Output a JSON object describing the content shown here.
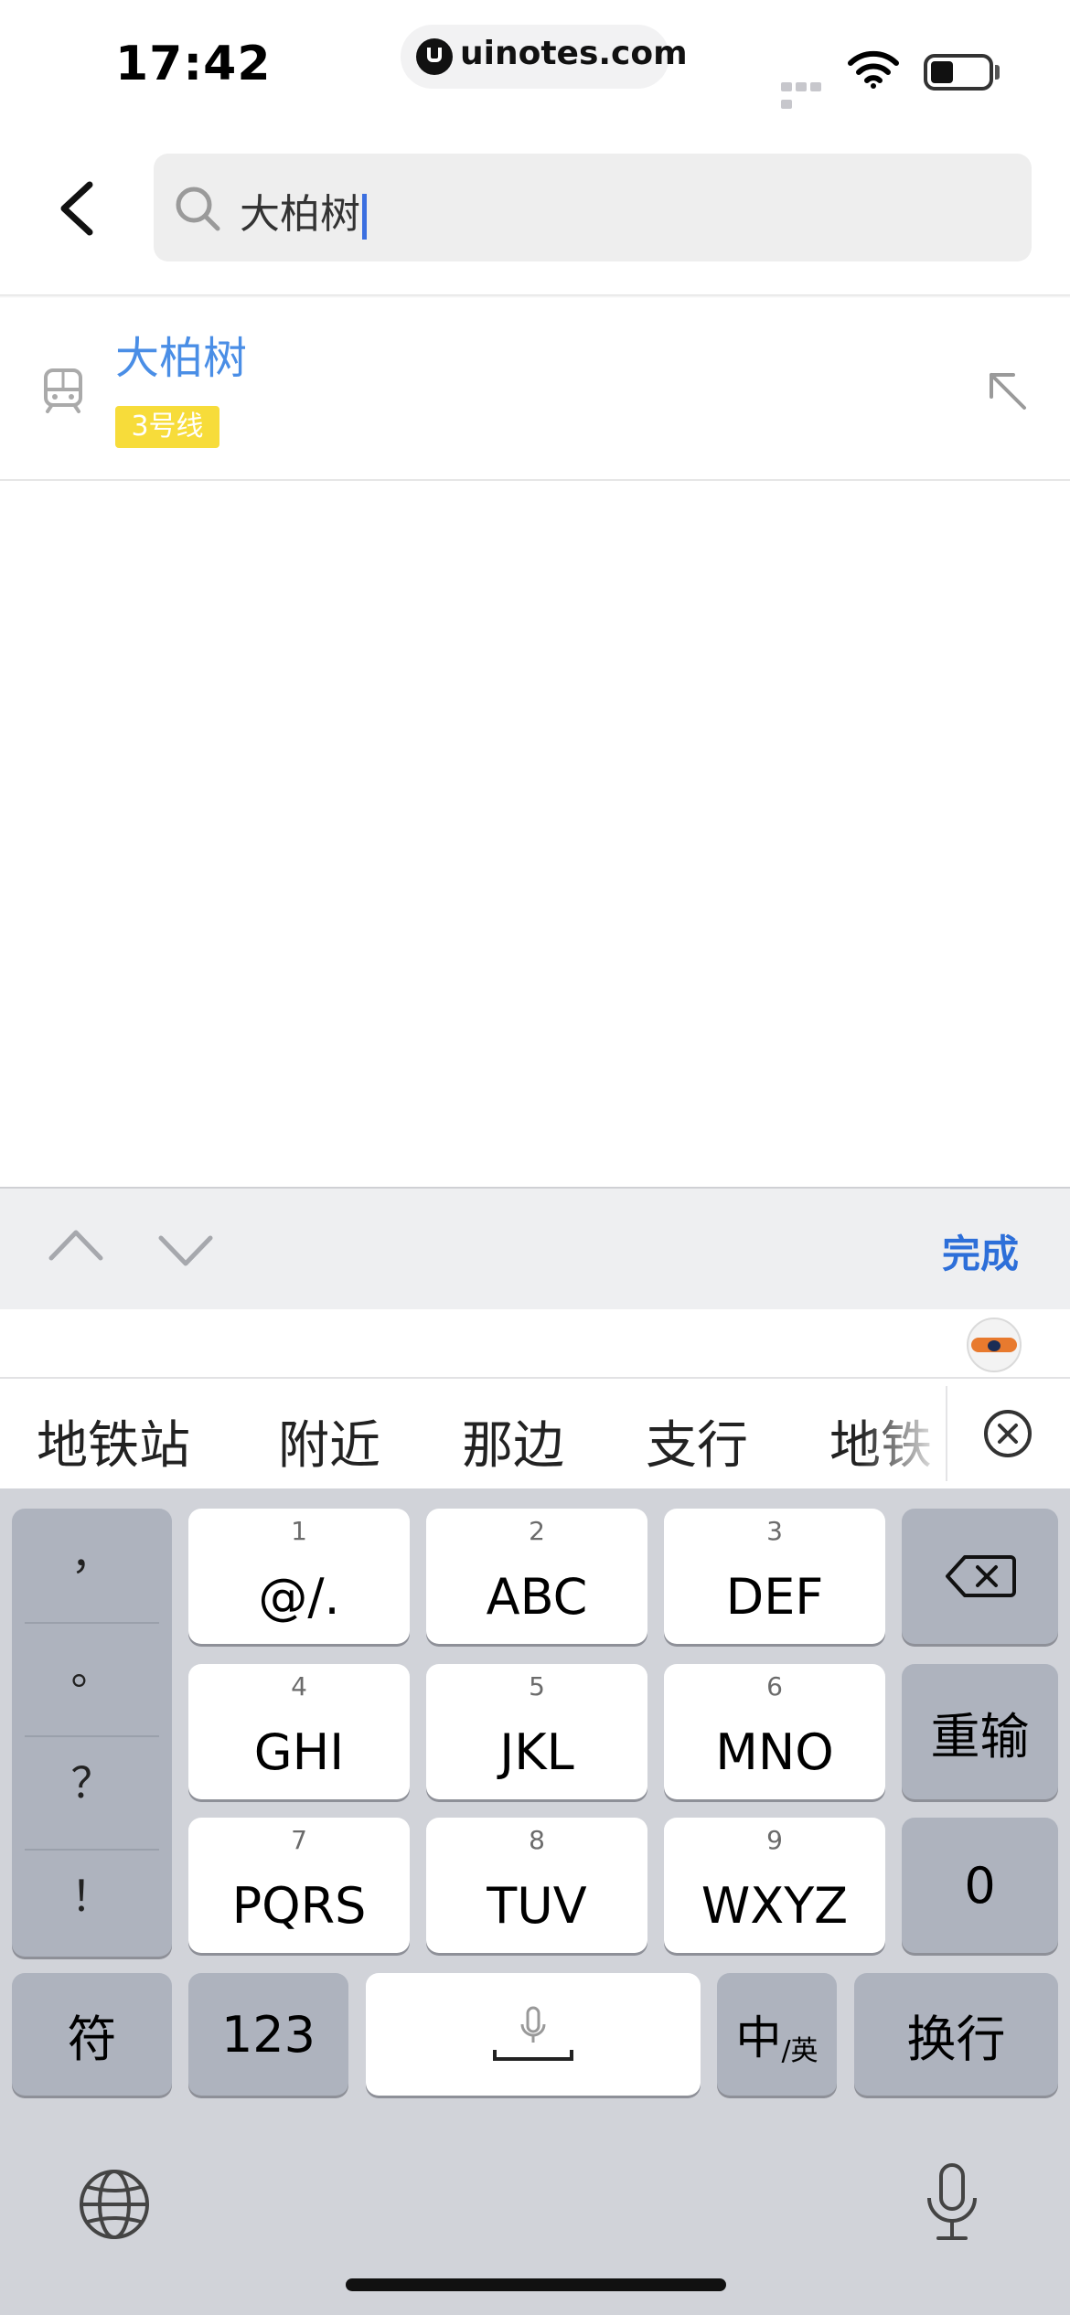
{
  "status_bar": {
    "time": "17:42",
    "url": "uinotes.com",
    "battery_level": 0.4
  },
  "search": {
    "query": "大柏树"
  },
  "results": [
    {
      "title": "大柏树",
      "badge": "3号线",
      "badge_color": "#f7dc3a",
      "title_color": "#4a8ee6"
    }
  ],
  "accessory": {
    "done_label": "完成",
    "done_color": "#2d6fd9"
  },
  "candidates": [
    "地铁站",
    "附近",
    "那边",
    "支行",
    "地铁"
  ],
  "keyboard": {
    "punctuation": [
      "，",
      "。",
      "？",
      "！"
    ],
    "row1": [
      {
        "num": "1",
        "letters": "@/."
      },
      {
        "num": "2",
        "letters": "ABC"
      },
      {
        "num": "3",
        "letters": "DEF"
      }
    ],
    "row2": [
      {
        "num": "4",
        "letters": "GHI"
      },
      {
        "num": "5",
        "letters": "JKL"
      },
      {
        "num": "6",
        "letters": "MNO"
      }
    ],
    "row3": [
      {
        "num": "7",
        "letters": "PQRS"
      },
      {
        "num": "8",
        "letters": "TUV"
      },
      {
        "num": "9",
        "letters": "WXYZ"
      }
    ],
    "reset_label": "重输",
    "zero_label": "0",
    "symbols_label": "符",
    "numbers_label": "123",
    "lang_label_main": "中",
    "lang_label_sub": "/英",
    "return_label": "换行"
  }
}
